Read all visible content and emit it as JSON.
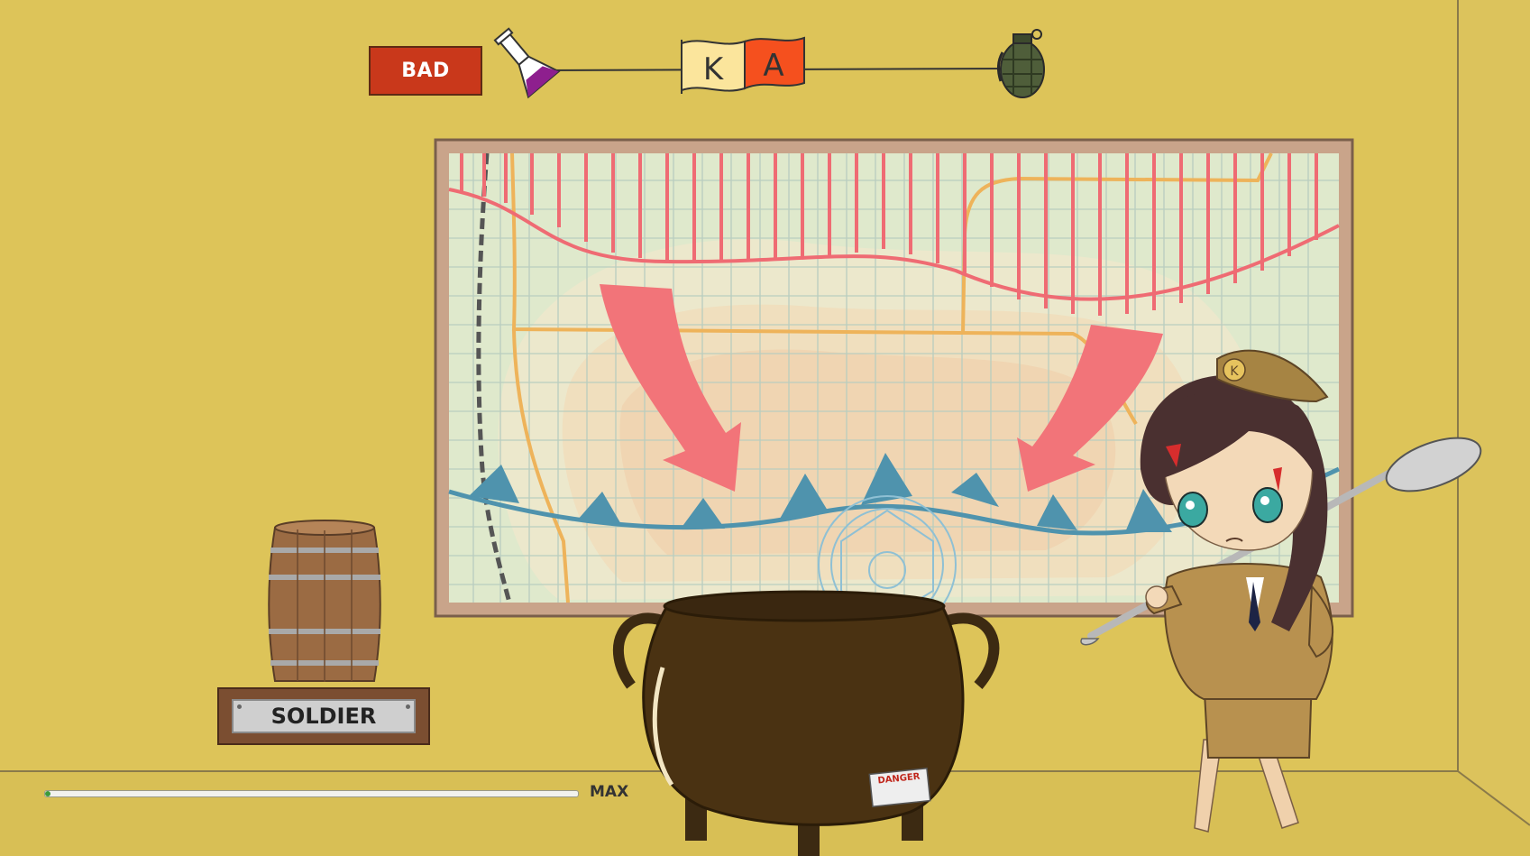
{
  "hud": {
    "status_label": "BAD",
    "progress_max_label": "MAX",
    "progress_fraction": 0.01,
    "progress_color": "#3c9a3a"
  },
  "timeline": {
    "flag_letters": [
      "K",
      "A"
    ],
    "start_marker_icon": "potion-flask-icon",
    "end_marker_icon": "grenade-icon"
  },
  "scene": {
    "plaque_label": "SOLDIER",
    "cauldron_label": "DANGER",
    "hat_letter": "K",
    "wall_color": "#ddc459",
    "front_line_color": "#4f93ad",
    "enemy_line_color": "#ef6b73"
  }
}
